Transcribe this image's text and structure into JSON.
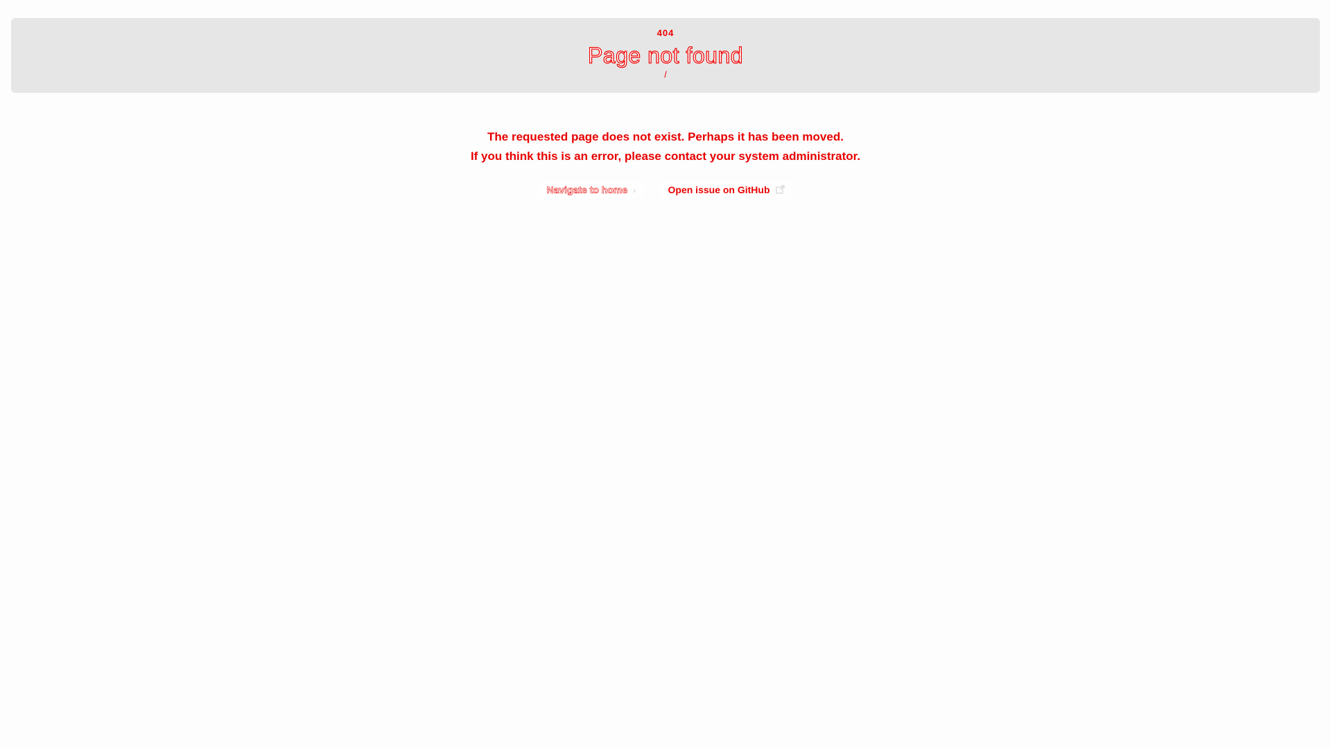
{
  "header": {
    "code": "404",
    "title": "Page not found",
    "path": "/"
  },
  "message": {
    "line1": "The requested page does not exist.  Perhaps it has been moved.",
    "line2": "If you think this is an error, please contact your system administrator."
  },
  "actions": {
    "home_label": "Navigate to home",
    "home_icon": "chevron-right-icon",
    "github_label": "Open issue on GitHub",
    "github_icon": "external-link-icon"
  },
  "colors": {
    "background": "#fdfdfd",
    "header_background": "#e6e6e6",
    "accent": "#e80000"
  }
}
